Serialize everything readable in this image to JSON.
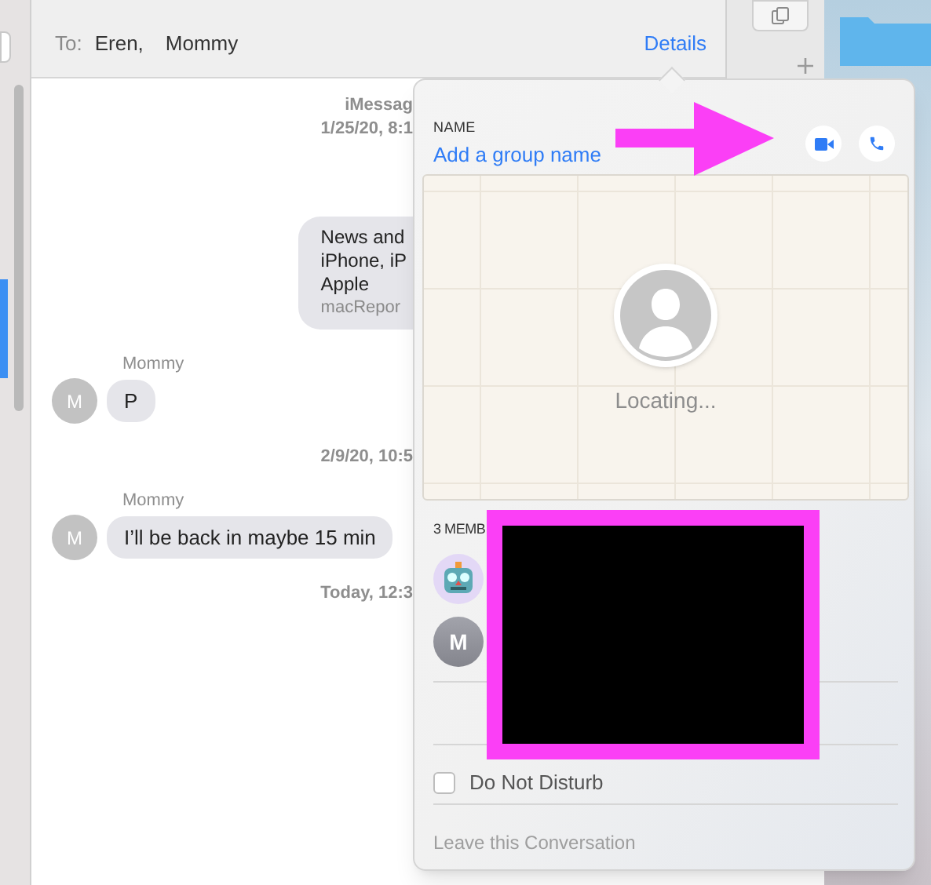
{
  "header": {
    "to_label": "To:",
    "recipients": [
      "Eren,",
      "Mommy"
    ],
    "details_link": "Details"
  },
  "messages": [
    {
      "kind": "timestamp",
      "lines": [
        "iMessag",
        "1/25/20, 8:1"
      ]
    },
    {
      "kind": "outgoing",
      "lines": [
        "News and",
        "iPhone, iP",
        "Apple"
      ],
      "source": "macRepor"
    },
    {
      "kind": "incoming",
      "sender": "Mommy",
      "avatar": "M",
      "text": "P"
    },
    {
      "kind": "timestamp",
      "lines": [
        "2/9/20, 10:5"
      ]
    },
    {
      "kind": "incoming",
      "sender": "Mommy",
      "avatar": "M",
      "text": "I’ll be back in maybe 15 min"
    },
    {
      "kind": "timestamp",
      "lines": [
        "Today, 12:3"
      ]
    }
  ],
  "details": {
    "name_label": "NAME",
    "name_placeholder": "Add a group name",
    "map_status": "Locating...",
    "members_label": "3 MEMB",
    "members": [
      {
        "kind": "emoji"
      },
      {
        "kind": "initial",
        "avatar": "M"
      }
    ],
    "do_not_disturb": {
      "label": "Do Not Disturb",
      "checked": false
    },
    "leave": {
      "label": "Leave this Conversation",
      "disabled": true
    }
  }
}
